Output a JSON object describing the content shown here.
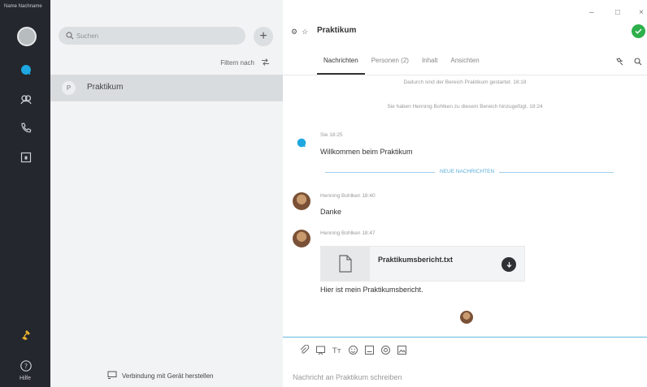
{
  "rail": {
    "title": "Name Nachname",
    "items": [
      {
        "icon": "chat-bubble-icon",
        "active": true
      },
      {
        "icon": "contacts-icon",
        "active": false
      },
      {
        "icon": "phone-icon",
        "active": false
      },
      {
        "icon": "calendar-icon",
        "active": false
      }
    ],
    "help_label": "Hilfe"
  },
  "list": {
    "search": {
      "placeholder": "Suchen"
    },
    "filter_label": "Filtern nach",
    "items": [
      {
        "label": "Praktikum"
      }
    ],
    "connect_label": "Verbindung mit Gerät herstellen"
  },
  "chat": {
    "title": "Praktikum",
    "tabs": [
      {
        "label": "Nachrichten",
        "active": true
      },
      {
        "label": "Personen (2)",
        "active": false
      },
      {
        "label": "Inhalt",
        "active": false
      },
      {
        "label": "Ansichten",
        "active": false
      }
    ],
    "system_messages": [
      "Dadurch sind der Bereich Praktikum gestartet. 18:18",
      "Sie haben Henning Bohlken zu diesem Bereich hinzugefügt. 18:24"
    ],
    "messages": [
      {
        "meta": "Sie   18:25",
        "text": "Willkommen beim Praktikum"
      },
      {
        "meta": "Henning Bohlken   18:40",
        "text": "Danke"
      },
      {
        "meta": "Henning Bohlken   18:47",
        "text": "Hier ist mein Praktikumsbericht."
      }
    ],
    "new_messages_label": "NEUE NACHRICHTEN",
    "file": {
      "name": "Praktikumsbericht.txt"
    },
    "compose": {
      "placeholder": "Nachricht an Praktikum schreiben"
    }
  },
  "colors": {
    "rail": "#24272d",
    "accent": "#1ea7e0",
    "status": "#2eaf4b",
    "list_bg": "#f2f3f4"
  }
}
